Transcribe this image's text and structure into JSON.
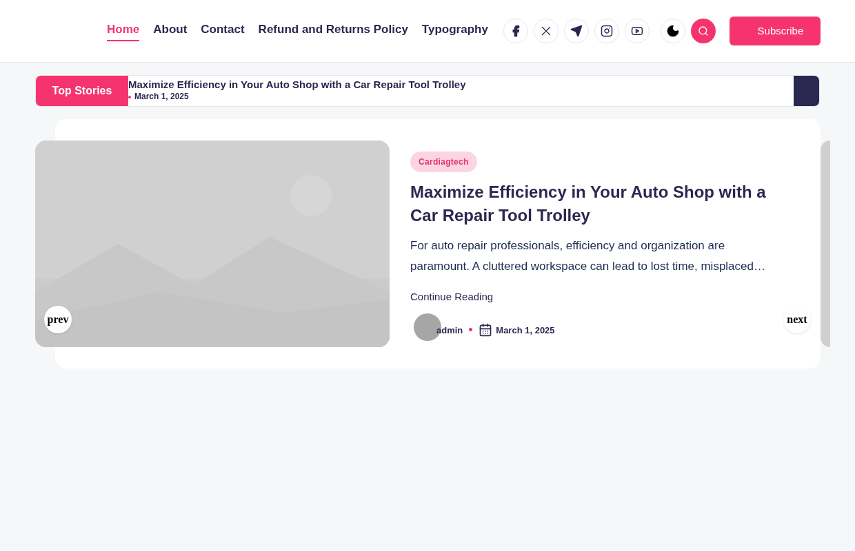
{
  "nav": [
    {
      "label": "Home",
      "selected": true
    },
    {
      "label": "About",
      "selected": false
    },
    {
      "label": "Contact",
      "selected": false
    },
    {
      "label": "Refund and Returns Policy",
      "selected": false
    },
    {
      "label": "Typography",
      "selected": false
    }
  ],
  "social": [
    {
      "kind": "facebook"
    },
    {
      "kind": "x"
    },
    {
      "kind": "telegram"
    },
    {
      "kind": "instagram"
    },
    {
      "kind": "youtube"
    }
  ],
  "subscribe": "Subscribe",
  "ticker": {
    "label": "Top Stories",
    "items": [
      {
        "title": "Maximize Efficiency in Your Auto Shop with a Car Repair Tool Trolley",
        "date": "March 1, 2025"
      }
    ]
  },
  "slide": {
    "category": "Cardiagtech",
    "title": "Maximize Efficiency in Your Auto Shop with a Car Repair Tool Trolley",
    "excerpt": "For auto repair professionals, efficiency and organization are paramount. A cluttered workspace can lead to lost time, misplaced…",
    "more": "Continue Reading",
    "author": "admin",
    "date": "March 1, 2025",
    "prev": "prev",
    "next": "next"
  }
}
